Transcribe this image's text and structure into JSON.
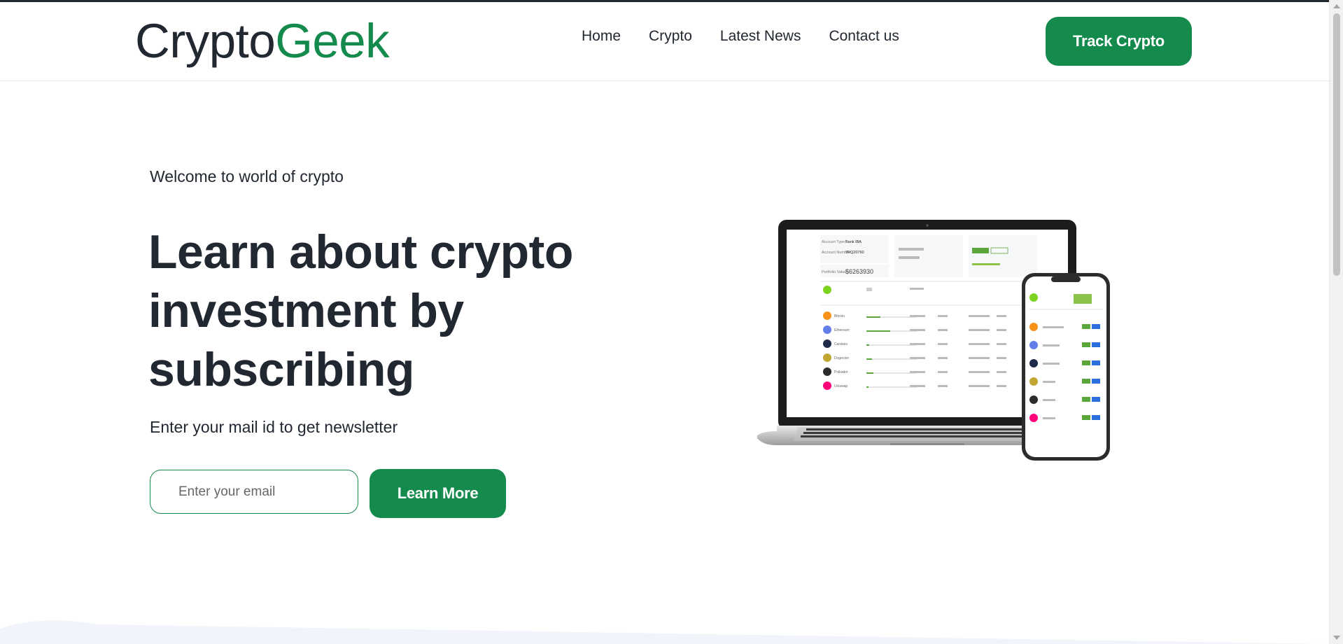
{
  "brand": {
    "part1": "Crypto",
    "part2": "Geek",
    "accent": "#148a4c",
    "dark": "#222831"
  },
  "nav": {
    "items": [
      "Home",
      "Crypto",
      "Latest News",
      "Contact us"
    ]
  },
  "header": {
    "track_label": "Track Crypto"
  },
  "hero": {
    "welcome": "Welcome to world of crypto",
    "headline_lines": [
      "Learn about crypto",
      "investment by",
      "subscribing"
    ],
    "subtext": "Enter your mail id to get newsletter",
    "email_placeholder": "Enter your email",
    "cta_label": "Learn More"
  },
  "mockup": {
    "account_type_label": "Account Type",
    "account_type": "Bank IBA",
    "account_number_label": "Account Number",
    "account_number": "7RQ20760",
    "portfolio_label": "Portfolio Value",
    "portfolio_value": "$6263930",
    "assets": [
      "Bitcoin",
      "Ethereum",
      "Cardano",
      "Dogecoin",
      "Polkadot",
      "Uniswap"
    ]
  }
}
